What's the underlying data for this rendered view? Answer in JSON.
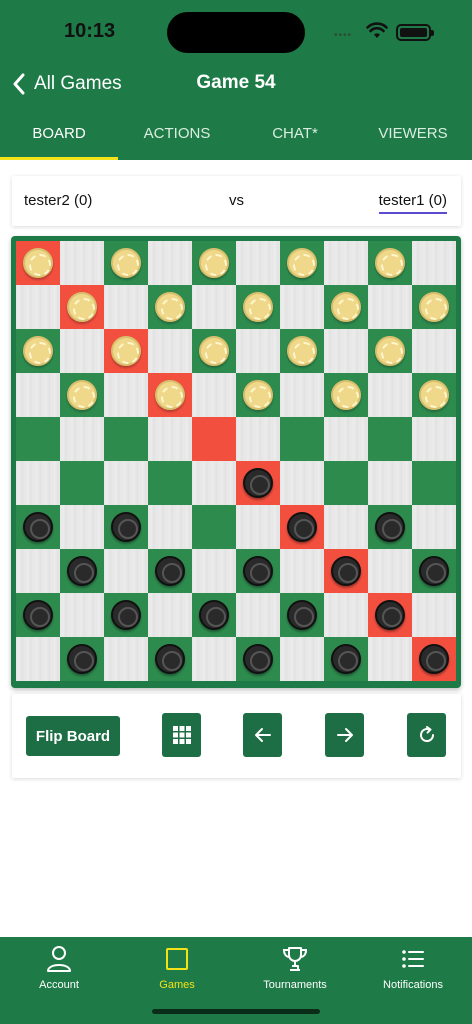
{
  "status": {
    "time": "10:13"
  },
  "nav": {
    "back_label": "All Games",
    "title": "Game 54"
  },
  "tabs": [
    {
      "label": "BOARD",
      "active": true
    },
    {
      "label": "ACTIONS",
      "active": false
    },
    {
      "label": "CHAT*",
      "active": false
    },
    {
      "label": "VIEWERS",
      "active": false
    }
  ],
  "players": {
    "left": "tester2 (0)",
    "vs": "vs",
    "right": "tester1 (0)"
  },
  "board": {
    "size": 10,
    "highlighted_squares": [
      "0,0",
      "1,1",
      "2,2",
      "3,3",
      "4,4",
      "5,5",
      "6,6",
      "7,7",
      "8,8",
      "9,9"
    ],
    "light_pieces": [
      "0,0",
      "0,2",
      "0,4",
      "0,6",
      "0,8",
      "1,1",
      "1,3",
      "1,5",
      "1,7",
      "1,9",
      "2,0",
      "2,2",
      "2,4",
      "2,6",
      "2,8",
      "3,1",
      "3,3",
      "3,5",
      "3,7",
      "3,9"
    ],
    "dark_pieces": [
      "5,5",
      "6,0",
      "6,2",
      "6,6",
      "6,8",
      "7,1",
      "7,3",
      "7,5",
      "7,7",
      "7,9",
      "8,0",
      "8,2",
      "8,4",
      "8,6",
      "8,8",
      "9,1",
      "9,3",
      "9,5",
      "9,7",
      "9,9"
    ]
  },
  "controls": {
    "flip_label": "Flip Board",
    "icons": [
      "grid-icon",
      "arrow-left-icon",
      "arrow-right-icon",
      "refresh-icon"
    ]
  },
  "bottom_nav": [
    {
      "label": "Account",
      "icon": "person-icon",
      "active": false
    },
    {
      "label": "Games",
      "icon": "square-icon",
      "active": true
    },
    {
      "label": "Tournaments",
      "icon": "trophy-icon",
      "active": false
    },
    {
      "label": "Notifications",
      "icon": "list-icon",
      "active": false
    }
  ],
  "colors": {
    "primary": "#1e7a46",
    "accent": "#f2e21a",
    "highlight": "#f24f3f"
  }
}
